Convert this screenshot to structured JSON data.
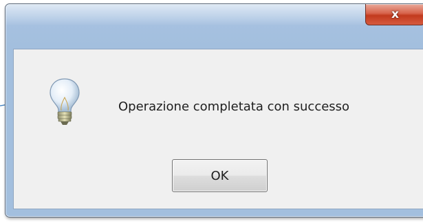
{
  "dialog": {
    "close_label": "x",
    "message": "Operazione completata con successo",
    "icon": "lightbulb-icon",
    "ok_label": "OK"
  },
  "colors": {
    "frame": "#a3bfde",
    "close_button": "#c9432a",
    "client_background": "#f0f0f0"
  }
}
